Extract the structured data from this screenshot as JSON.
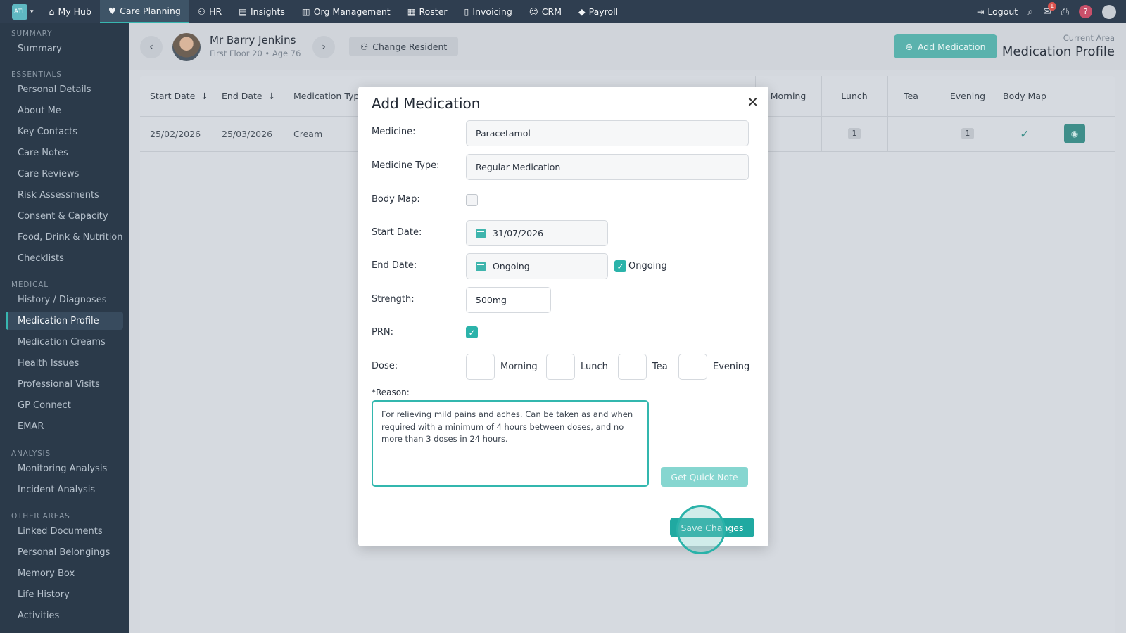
{
  "topnav": {
    "logo_text": "ATL",
    "items": [
      {
        "label": "My Hub",
        "icon": "home-icon"
      },
      {
        "label": "Care Planning",
        "icon": "heart-icon",
        "active": true
      },
      {
        "label": "HR",
        "icon": "people-icon"
      },
      {
        "label": "Insights",
        "icon": "chart-icon"
      },
      {
        "label": "Org Management",
        "icon": "building-icon"
      },
      {
        "label": "Roster",
        "icon": "calendar-icon"
      },
      {
        "label": "Invoicing",
        "icon": "document-icon"
      },
      {
        "label": "CRM",
        "icon": "contacts-icon"
      },
      {
        "label": "Payroll",
        "icon": "tag-icon"
      }
    ],
    "logout_label": "Logout",
    "notification_count": "1",
    "help_label": "?"
  },
  "sidebar": {
    "sections": [
      {
        "heading": "Summary",
        "items": [
          "Summary"
        ]
      },
      {
        "heading": "Essentials",
        "items": [
          "Personal Details",
          "About Me",
          "Key Contacts",
          "Care Notes",
          "Care Reviews",
          "Risk Assessments",
          "Consent & Capacity",
          "Food, Drink & Nutrition",
          "Checklists"
        ]
      },
      {
        "heading": "Medical",
        "items": [
          "History / Diagnoses",
          "Medication Profile",
          "Medication Creams",
          "Health Issues",
          "Professional Visits",
          "GP Connect",
          "EMAR"
        ]
      },
      {
        "heading": "Analysis",
        "items": [
          "Monitoring Analysis",
          "Incident Analysis"
        ]
      },
      {
        "heading": "Other Areas",
        "items": [
          "Linked Documents",
          "Personal Belongings",
          "Memory Box",
          "Life History",
          "Activities"
        ]
      }
    ],
    "active_item": "Medication Profile"
  },
  "header": {
    "resident_name": "Mr Barry Jenkins",
    "resident_location": "First Floor 20",
    "resident_age": "Age 76",
    "change_resident_label": "Change Resident",
    "add_medication_label": "Add Medication",
    "current_area_label": "Current Area",
    "current_area_value": "Medication Profile"
  },
  "table": {
    "columns": [
      "Start Date",
      "End Date",
      "Medication Type",
      "Morning",
      "Lunch",
      "Tea",
      "Evening",
      "Body Map"
    ],
    "rows": [
      {
        "start": "25/02/2026",
        "end": "25/03/2026",
        "type": "Cream",
        "morning": "",
        "lunch": "1",
        "tea": "",
        "evening": "1",
        "body_map": true
      }
    ]
  },
  "modal": {
    "title": "Add Medication",
    "medicine_label": "Medicine:",
    "medicine_value": "Paracetamol",
    "medicine_type_label": "Medicine Type:",
    "medicine_type_value": "Regular Medication",
    "body_map_label": "Body Map:",
    "body_map_checked": false,
    "start_date_label": "Start Date:",
    "start_date_value": "31/07/2026",
    "end_date_label": "End Date:",
    "end_date_value": "Ongoing",
    "ongoing_label": "Ongoing",
    "ongoing_checked": true,
    "strength_label": "Strength:",
    "strength_value": "500mg",
    "prn_label": "PRN:",
    "prn_checked": true,
    "dose_label": "Dose:",
    "dose_slots": [
      "Morning",
      "Lunch",
      "Tea",
      "Evening"
    ],
    "reason_label": "*Reason:",
    "reason_value": "For relieving mild pains and aches. Can be taken as and when required with a minimum of 4 hours between doses, and no more than 3 doses in 24 hours.",
    "quick_note_label": "Get Quick Note",
    "save_label": "Save Changes"
  },
  "colors": {
    "accent": "#2bb3aa",
    "nav_bg": "#2f3e50",
    "sidebar_bg": "#2b3a4a"
  }
}
